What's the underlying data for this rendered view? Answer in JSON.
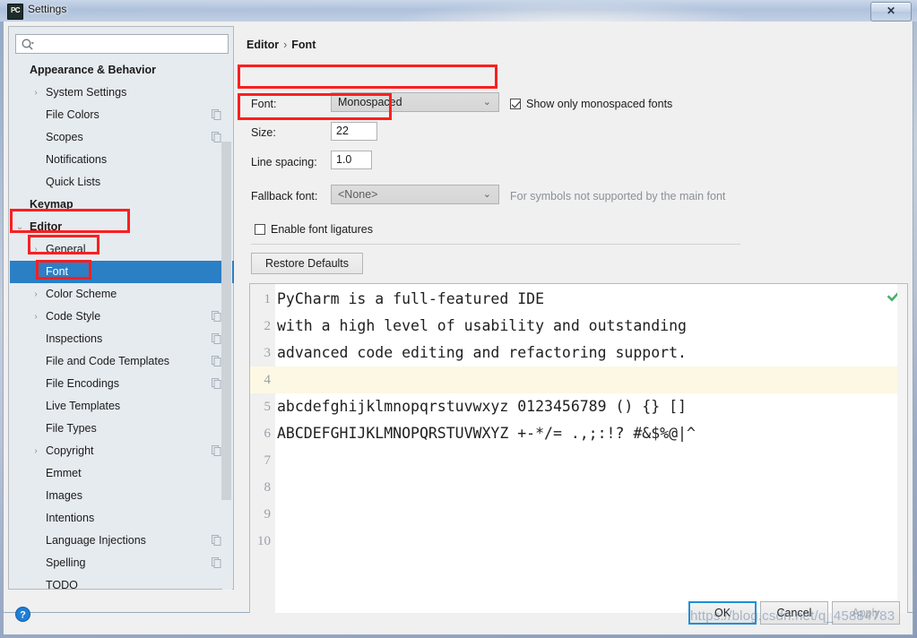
{
  "window": {
    "title": "Settings",
    "app_icon": "pycharm-icon",
    "close_label": "✕"
  },
  "sidebar": {
    "search": {
      "placeholder": "",
      "value": "",
      "icon": "search-icon"
    },
    "items": [
      {
        "label": "Appearance & Behavior",
        "bold": true,
        "arrow": "",
        "indent": 22,
        "copy": false,
        "selected": false
      },
      {
        "label": "System Settings",
        "bold": false,
        "arrow": "›",
        "indent": 40,
        "copy": false,
        "selected": false
      },
      {
        "label": "File Colors",
        "bold": false,
        "arrow": "",
        "indent": 40,
        "copy": true,
        "selected": false
      },
      {
        "label": "Scopes",
        "bold": false,
        "arrow": "",
        "indent": 40,
        "copy": true,
        "selected": false
      },
      {
        "label": "Notifications",
        "bold": false,
        "arrow": "",
        "indent": 40,
        "copy": false,
        "selected": false
      },
      {
        "label": "Quick Lists",
        "bold": false,
        "arrow": "",
        "indent": 40,
        "copy": false,
        "selected": false
      },
      {
        "label": "Keymap",
        "bold": true,
        "arrow": "",
        "indent": 22,
        "copy": false,
        "selected": false
      },
      {
        "label": "Editor",
        "bold": true,
        "arrow": "⌄",
        "indent": 22,
        "copy": false,
        "selected": false
      },
      {
        "label": "General",
        "bold": false,
        "arrow": "›",
        "indent": 40,
        "copy": false,
        "selected": false
      },
      {
        "label": "Font",
        "bold": false,
        "arrow": "",
        "indent": 40,
        "copy": false,
        "selected": true
      },
      {
        "label": "Color Scheme",
        "bold": false,
        "arrow": "›",
        "indent": 40,
        "copy": false,
        "selected": false
      },
      {
        "label": "Code Style",
        "bold": false,
        "arrow": "›",
        "indent": 40,
        "copy": true,
        "selected": false
      },
      {
        "label": "Inspections",
        "bold": false,
        "arrow": "",
        "indent": 40,
        "copy": true,
        "selected": false
      },
      {
        "label": "File and Code Templates",
        "bold": false,
        "arrow": "",
        "indent": 40,
        "copy": true,
        "selected": false
      },
      {
        "label": "File Encodings",
        "bold": false,
        "arrow": "",
        "indent": 40,
        "copy": true,
        "selected": false
      },
      {
        "label": "Live Templates",
        "bold": false,
        "arrow": "",
        "indent": 40,
        "copy": false,
        "selected": false
      },
      {
        "label": "File Types",
        "bold": false,
        "arrow": "",
        "indent": 40,
        "copy": false,
        "selected": false
      },
      {
        "label": "Copyright",
        "bold": false,
        "arrow": "›",
        "indent": 40,
        "copy": true,
        "selected": false
      },
      {
        "label": "Emmet",
        "bold": false,
        "arrow": "",
        "indent": 40,
        "copy": false,
        "selected": false
      },
      {
        "label": "Images",
        "bold": false,
        "arrow": "",
        "indent": 40,
        "copy": false,
        "selected": false
      },
      {
        "label": "Intentions",
        "bold": false,
        "arrow": "",
        "indent": 40,
        "copy": false,
        "selected": false
      },
      {
        "label": "Language Injections",
        "bold": false,
        "arrow": "",
        "indent": 40,
        "copy": true,
        "selected": false
      },
      {
        "label": "Spelling",
        "bold": false,
        "arrow": "",
        "indent": 40,
        "copy": true,
        "selected": false
      },
      {
        "label": "TODO",
        "bold": false,
        "arrow": "",
        "indent": 40,
        "copy": false,
        "selected": false
      }
    ]
  },
  "main": {
    "breadcrumb": {
      "root": "Editor",
      "separator": "›",
      "leaf": "Font"
    },
    "font": {
      "label": "Font:",
      "value": "Monospaced",
      "caret": "⌄"
    },
    "show_monospaced": {
      "label": "Show only monospaced fonts",
      "checked": true
    },
    "size": {
      "label": "Size:",
      "value": "22"
    },
    "line_spacing": {
      "label": "Line spacing:",
      "value": "1.0"
    },
    "fallback_font": {
      "label": "Fallback font:",
      "value": "<None>",
      "caret": "⌄",
      "hint": "For symbols not supported by the main font"
    },
    "ligatures": {
      "label": "Enable font ligatures",
      "checked": false
    },
    "restore_defaults": "Restore Defaults",
    "preview": {
      "check_icon": "green-check-icon",
      "lines": [
        {
          "num": "1",
          "text": "PyCharm is a full-featured IDE",
          "highlight": false
        },
        {
          "num": "2",
          "text": "with a high level of usability and outstanding",
          "highlight": false
        },
        {
          "num": "3",
          "text": "advanced code editing and refactoring support.",
          "highlight": false
        },
        {
          "num": "4",
          "text": "",
          "highlight": true
        },
        {
          "num": "5",
          "text": "abcdefghijklmnopqrstuvwxyz 0123456789 () {} []",
          "highlight": false
        },
        {
          "num": "6",
          "text": "ABCDEFGHIJKLMNOPQRSTUVWXYZ +-*/= .,;:!? #&$%@|^",
          "highlight": false
        },
        {
          "num": "7",
          "text": "",
          "highlight": false
        },
        {
          "num": "8",
          "text": "",
          "highlight": false
        },
        {
          "num": "9",
          "text": "",
          "highlight": false
        },
        {
          "num": "10",
          "text": "",
          "highlight": false
        }
      ]
    }
  },
  "footer": {
    "help_icon": "help-icon",
    "ok": "OK",
    "cancel": "Cancel",
    "apply": "Apply"
  },
  "watermark": "https://blog.csdn.net/q_45884783",
  "colors": {
    "selection": "#2b7fc4",
    "annotation": "#fb1f1f",
    "highlight_line": "#fdf8e3",
    "ok_border": "#1f8fd6"
  }
}
